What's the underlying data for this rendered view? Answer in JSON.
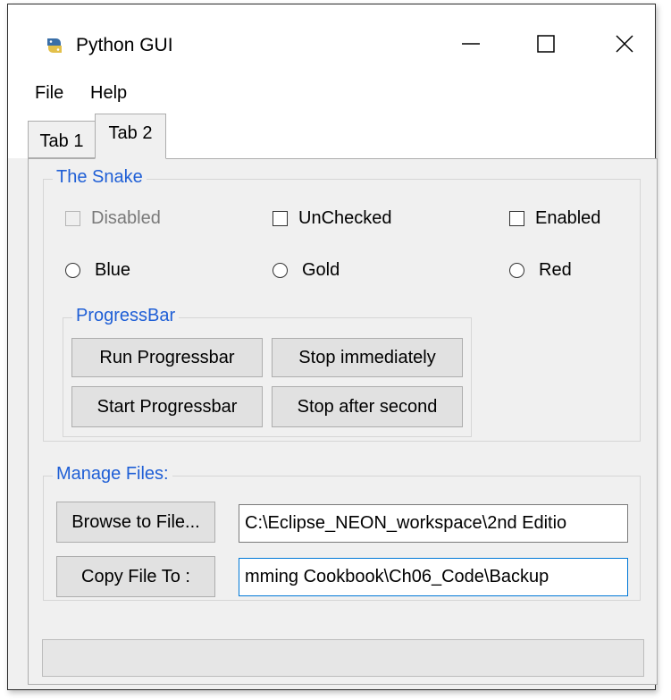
{
  "window": {
    "title": "Python GUI",
    "minimize_icon": "minimize-icon",
    "maximize_icon": "maximize-icon",
    "close_icon": "close-icon"
  },
  "menu": {
    "items": [
      "File",
      "Help"
    ]
  },
  "tabs": [
    {
      "label": "Tab 1",
      "selected": false
    },
    {
      "label": "Tab 2",
      "selected": true
    }
  ],
  "snake_group": {
    "title": "The Snake",
    "checkboxes": [
      {
        "label": "Disabled",
        "enabled": false,
        "checked": false
      },
      {
        "label": "UnChecked",
        "enabled": true,
        "checked": false
      },
      {
        "label": "Enabled",
        "enabled": true,
        "checked": false
      }
    ],
    "radios": [
      {
        "label": "Blue",
        "selected": false
      },
      {
        "label": "Gold",
        "selected": false
      },
      {
        "label": "Red",
        "selected": false
      }
    ]
  },
  "progress_group": {
    "title": "ProgressBar",
    "buttons": [
      "Run Progressbar",
      "Stop immediately",
      "Start Progressbar",
      "Stop after second"
    ]
  },
  "files_group": {
    "title": "Manage Files:",
    "browse_button": "Browse to File...",
    "browse_value": "C:\\Eclipse_NEON_workspace\\2nd Editio",
    "copy_button": "Copy File To :",
    "copy_value": "mming Cookbook\\Ch06_Code\\Backup"
  },
  "progressbar": {
    "value": 0
  },
  "colors": {
    "group_title": "#1f5fd6",
    "focus_border": "#0078d7"
  }
}
